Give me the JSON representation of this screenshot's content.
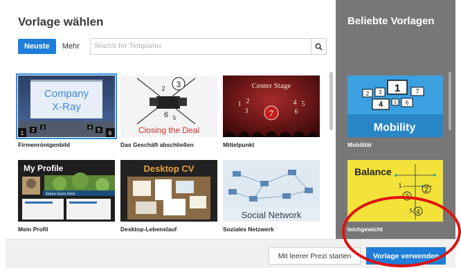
{
  "dialog": {
    "title": "Vorlage wählen",
    "tabs": [
      {
        "label": "Neuste",
        "active": true
      },
      {
        "label": "Mehr",
        "active": false
      }
    ],
    "search": {
      "placeholder": "Search for Templates",
      "value": "",
      "icon": "search-icon"
    },
    "templates": [
      {
        "label": "Firmenröntgenbild",
        "selected": true,
        "thumb": {
          "lines": [
            "Company",
            "X-Ray"
          ],
          "nums": [
            "1",
            "2",
            "3",
            "4",
            "5",
            "6"
          ]
        }
      },
      {
        "label": "Das Geschäft abschließen",
        "selected": false,
        "thumb": {
          "caption": "Closing the Deal",
          "nums": [
            "2",
            "3",
            "6",
            "5"
          ]
        }
      },
      {
        "label": "Mittelpunkt",
        "selected": false,
        "thumb": {
          "caption": "Center Stage",
          "nums": [
            "1",
            "2",
            "3",
            "7",
            "4",
            "5",
            "6"
          ]
        }
      },
      {
        "label": "Mein Profil",
        "selected": false,
        "thumb": {
          "caption": "My Profile",
          "name_bar": "Name Goes Here"
        }
      },
      {
        "label": "Desktop-Lebenslauf",
        "selected": false,
        "thumb": {
          "caption": "Desktop CV"
        }
      },
      {
        "label": "Soziales Netzwerk",
        "selected": false,
        "thumb": {
          "caption": "Social Network"
        }
      }
    ]
  },
  "popular": {
    "title": "Beliebte Vorlagen",
    "templates": [
      {
        "label": "Mobilität",
        "thumb": {
          "caption": "Mobility",
          "nums": [
            "2",
            "3",
            "1",
            "7",
            "4",
            "5",
            "6"
          ]
        }
      },
      {
        "label": "leichgewicht",
        "thumb": {
          "caption": "Balance",
          "nums": [
            "1",
            "2",
            "3",
            "5",
            "4"
          ]
        }
      }
    ]
  },
  "footer": {
    "secondary_label": "Mit leerer Prezi starten",
    "primary_label": "Vorlage verwenden"
  },
  "colors": {
    "accent": "#1f7ed8",
    "panel": "#777777",
    "annotation": "#e01010"
  }
}
